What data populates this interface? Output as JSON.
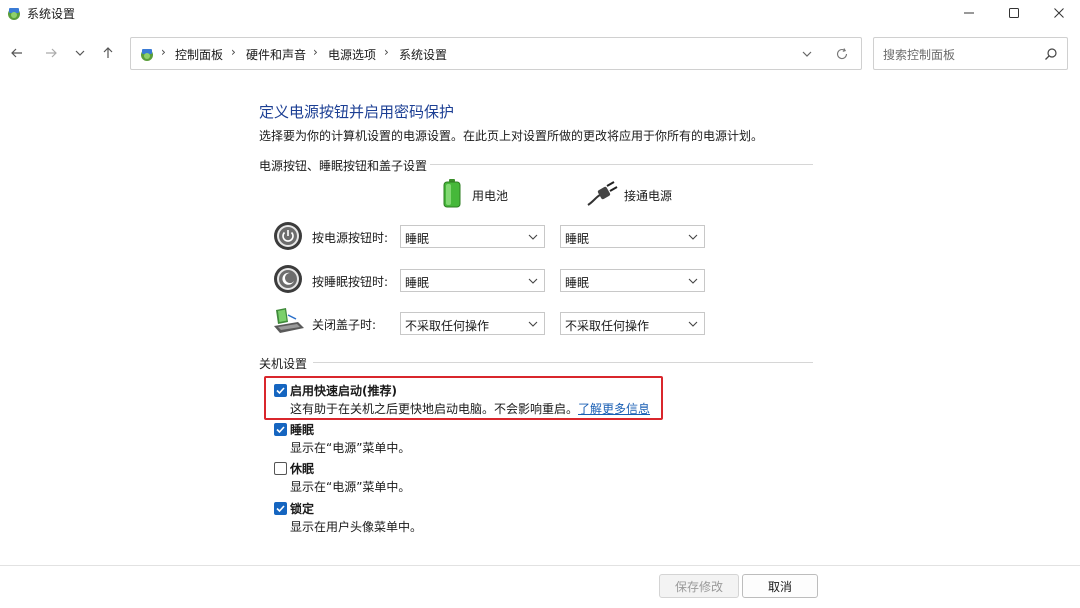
{
  "window": {
    "title": "系统设置"
  },
  "nav": {
    "breadcrumbs": [
      "控制面板",
      "硬件和声音",
      "电源选项",
      "系统设置"
    ],
    "search_placeholder": "搜索控制面板"
  },
  "main": {
    "heading": "定义电源按钮并启用密码保护",
    "description": "选择要为你的计算机设置的电源设置。在此页上对设置所做的更改将应用于你所有的电源计划。",
    "buttons_section_title": "电源按钮、睡眠按钮和盖子设置",
    "columns": {
      "battery": "用电池",
      "plugged": "接通电源"
    },
    "rows": [
      {
        "label": "按电源按钮时:",
        "battery": "睡眠",
        "plugged": "睡眠"
      },
      {
        "label": "按睡眠按钮时:",
        "battery": "睡眠",
        "plugged": "睡眠"
      },
      {
        "label": "关闭盖子时:",
        "battery": "不采取任何操作",
        "plugged": "不采取任何操作"
      }
    ],
    "shutdown_section_title": "关机设置",
    "shutdown_options": [
      {
        "title": "启用快速启动(推荐)",
        "desc": "这有助于在关机之后更快地启动电脑。不会影响重启。",
        "link": "了解更多信息",
        "checked": true
      },
      {
        "title": "睡眠",
        "desc": "显示在“电源”菜单中。",
        "checked": true
      },
      {
        "title": "休眠",
        "desc": "显示在“电源”菜单中。",
        "checked": false
      },
      {
        "title": "锁定",
        "desc": "显示在用户头像菜单中。",
        "checked": true
      }
    ]
  },
  "footer": {
    "save_label": "保存修改",
    "cancel_label": "取消"
  },
  "colors": {
    "heading": "#1c3f94",
    "checkbox": "#1565c0",
    "highlight": "#d9262c",
    "link": "#1a5fb4"
  }
}
